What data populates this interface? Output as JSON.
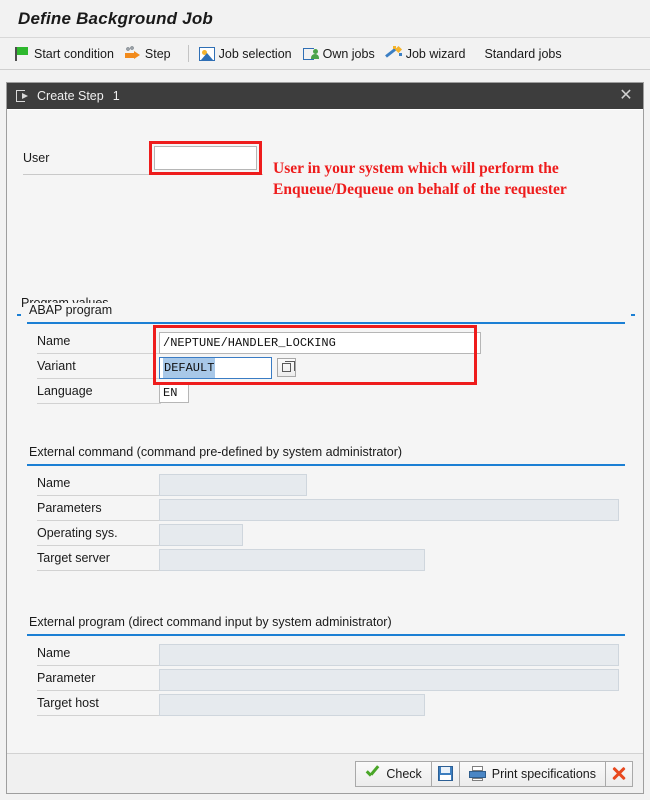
{
  "header": {
    "title": "Define Background Job"
  },
  "toolbar": {
    "items": [
      {
        "label": "Start condition",
        "icon": "flag-icon"
      },
      {
        "label": "Step",
        "icon": "step-icon"
      },
      {
        "label": "Job selection",
        "icon": "job-selection-icon"
      },
      {
        "label": "Own jobs",
        "icon": "own-jobs-icon"
      },
      {
        "label": "Job wizard",
        "icon": "wand-icon"
      },
      {
        "label": "Standard jobs",
        "icon": "none"
      }
    ]
  },
  "dialog": {
    "title": "Create Step",
    "step_number": "1",
    "close_label": "✕",
    "user": {
      "label": "User",
      "value": "",
      "placeholder": ""
    },
    "annotation": "User in your system which will perform the Enqueue/Dequeue on behalf of the requester",
    "program_values": {
      "legend": "Program values",
      "buttons": [
        "ABAP program",
        "External command",
        "External program"
      ]
    },
    "abap_program": {
      "legend": "ABAP program",
      "fields": [
        {
          "label": "Name",
          "value": "/NEPTUNE/HANDLER_LOCKING"
        },
        {
          "label": "Variant",
          "value": "DEFAULT"
        },
        {
          "label": "Language",
          "value": "EN"
        }
      ]
    },
    "external_command": {
      "legend": "External command (command pre-defined by system administrator)",
      "fields": [
        {
          "label": "Name",
          "value": ""
        },
        {
          "label": "Parameters",
          "value": ""
        },
        {
          "label": "Operating sys.",
          "value": ""
        },
        {
          "label": "Target server",
          "value": ""
        }
      ]
    },
    "external_program": {
      "legend": "External program (direct command input by system administrator)",
      "fields": [
        {
          "label": "Name",
          "value": ""
        },
        {
          "label": "Parameter",
          "value": ""
        },
        {
          "label": "Target host",
          "value": ""
        }
      ]
    },
    "footer": {
      "check_label": "Check",
      "print_label": "Print specifications"
    }
  },
  "colors": {
    "annotation_red": "#ee1c1c",
    "section_rule_blue": "#1b7fd4",
    "titlebar_dark": "#3d3d3d",
    "selection_blue": "#a8c8e8"
  }
}
